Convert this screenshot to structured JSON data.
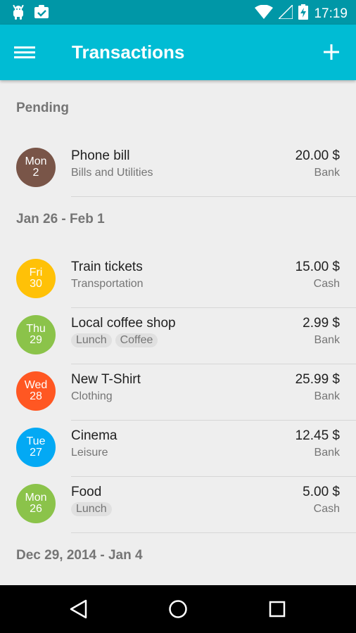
{
  "status_bar": {
    "time": "17:19",
    "left_icons": [
      "android-icon",
      "clipboard-check-icon"
    ],
    "right_icons": [
      "wifi-icon",
      "signal-icon",
      "battery-charging-icon"
    ]
  },
  "app_bar": {
    "title": "Transactions",
    "menu_icon": "hamburger-menu-icon",
    "add_icon": "plus-icon",
    "color": "#00bcd4"
  },
  "sections": [
    {
      "header": "Pending",
      "items": [
        {
          "day": "Mon",
          "date": "2",
          "color": "#795548",
          "name": "Phone bill",
          "category": "Bills and Utilities",
          "tags": [],
          "amount": "20.00 $",
          "account": "Bank"
        }
      ]
    },
    {
      "header": "Jan 26 - Feb 1",
      "items": [
        {
          "day": "Fri",
          "date": "30",
          "color": "#ffc107",
          "name": "Train tickets",
          "category": "Transportation",
          "tags": [],
          "amount": "15.00 $",
          "account": "Cash"
        },
        {
          "day": "Thu",
          "date": "29",
          "color": "#8bc34a",
          "name": "Local coffee shop",
          "category": "",
          "tags": [
            "Lunch",
            "Coffee"
          ],
          "amount": "2.99 $",
          "account": "Bank"
        },
        {
          "day": "Wed",
          "date": "28",
          "color": "#ff5722",
          "name": "New T-Shirt",
          "category": "Clothing",
          "tags": [],
          "amount": "25.99 $",
          "account": "Bank"
        },
        {
          "day": "Tue",
          "date": "27",
          "color": "#03a9f4",
          "name": "Cinema",
          "category": "Leisure",
          "tags": [],
          "amount": "12.45 $",
          "account": "Bank"
        },
        {
          "day": "Mon",
          "date": "26",
          "color": "#8bc34a",
          "name": "Food",
          "category": "",
          "tags": [
            "Lunch"
          ],
          "amount": "5.00 $",
          "account": "Cash"
        }
      ]
    },
    {
      "header": "Dec 29, 2014 - Jan 4",
      "items": []
    }
  ],
  "nav_bar": {
    "icons": [
      "back-triangle-icon",
      "home-circle-icon",
      "recents-square-icon"
    ]
  }
}
